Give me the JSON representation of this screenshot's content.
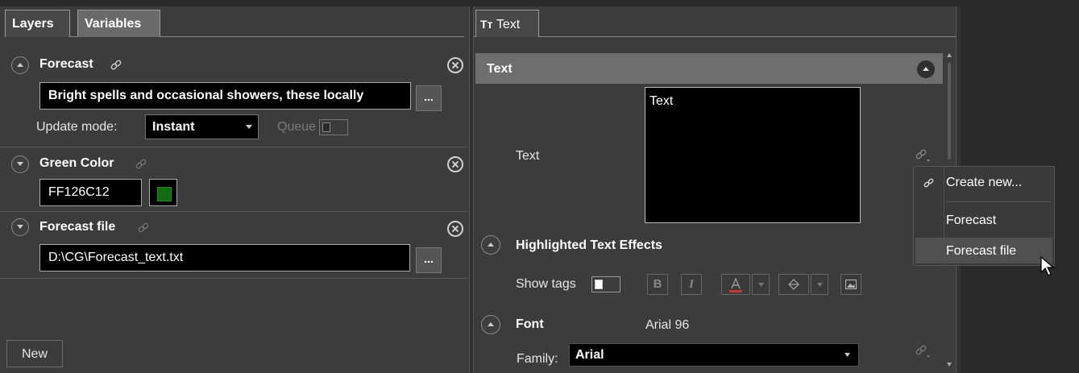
{
  "left_panel": {
    "tabs": [
      {
        "label": "Layers"
      },
      {
        "label": "Variables"
      }
    ],
    "variables": [
      {
        "name": "Forecast",
        "value": "Bright spells and occasional showers, these locally",
        "browse_label": "...",
        "update_mode_label": "Update mode:",
        "update_mode_value": "Instant",
        "queue_label": "Queue"
      },
      {
        "name": "Green Color",
        "value": "FF126C12",
        "swatch_color": "#126C12"
      },
      {
        "name": "Forecast file",
        "value": "D:\\CG\\Forecast_text.txt",
        "browse_label": "..."
      }
    ],
    "new_button": "New"
  },
  "right_panel": {
    "tab_icon": "Tт",
    "tab_label": "Text",
    "section_header": "Text",
    "text_property_label": "Text",
    "text_value": "Text",
    "highlight_section": "Highlighted Text Effects",
    "show_tags_label": "Show tags",
    "format_buttons": [
      "B",
      "I"
    ],
    "font_section": "Font",
    "font_summary": "Arial 96",
    "family_label": "Family:",
    "family_value": "Arial"
  },
  "link_menu": {
    "items": [
      {
        "label": "Create new..."
      },
      {
        "label": "Forecast"
      },
      {
        "label": "Forecast file"
      }
    ]
  },
  "colors": {
    "accent_header": "#6e6e6e",
    "panel": "#3c3c3c",
    "field": "#000000"
  }
}
